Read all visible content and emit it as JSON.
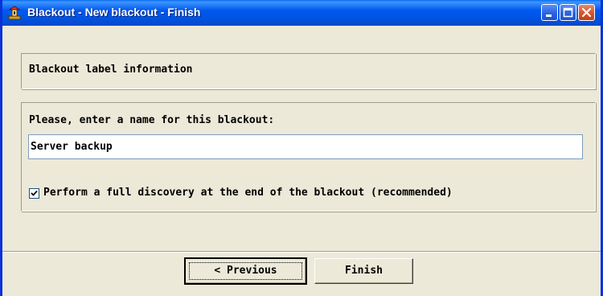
{
  "window": {
    "title": "Blackout - New blackout - Finish",
    "app_icon": "blackout-app-icon",
    "controls": [
      "minimize-icon",
      "maximize-icon",
      "close-icon"
    ]
  },
  "header": {
    "text": "Blackout label information"
  },
  "form": {
    "prompt": "Please, enter a name for this blackout:",
    "name_value": "Server backup",
    "checkbox_checked": true,
    "checkbox_label": "Perform a full discovery at the end of the blackout (recommended)"
  },
  "buttons": {
    "previous_label": "< Previous",
    "finish_label": "Finish"
  },
  "colors": {
    "titlebar": "#0054e3",
    "frame": "#0831d9",
    "face": "#ece9d8",
    "close": "#d5522e"
  }
}
